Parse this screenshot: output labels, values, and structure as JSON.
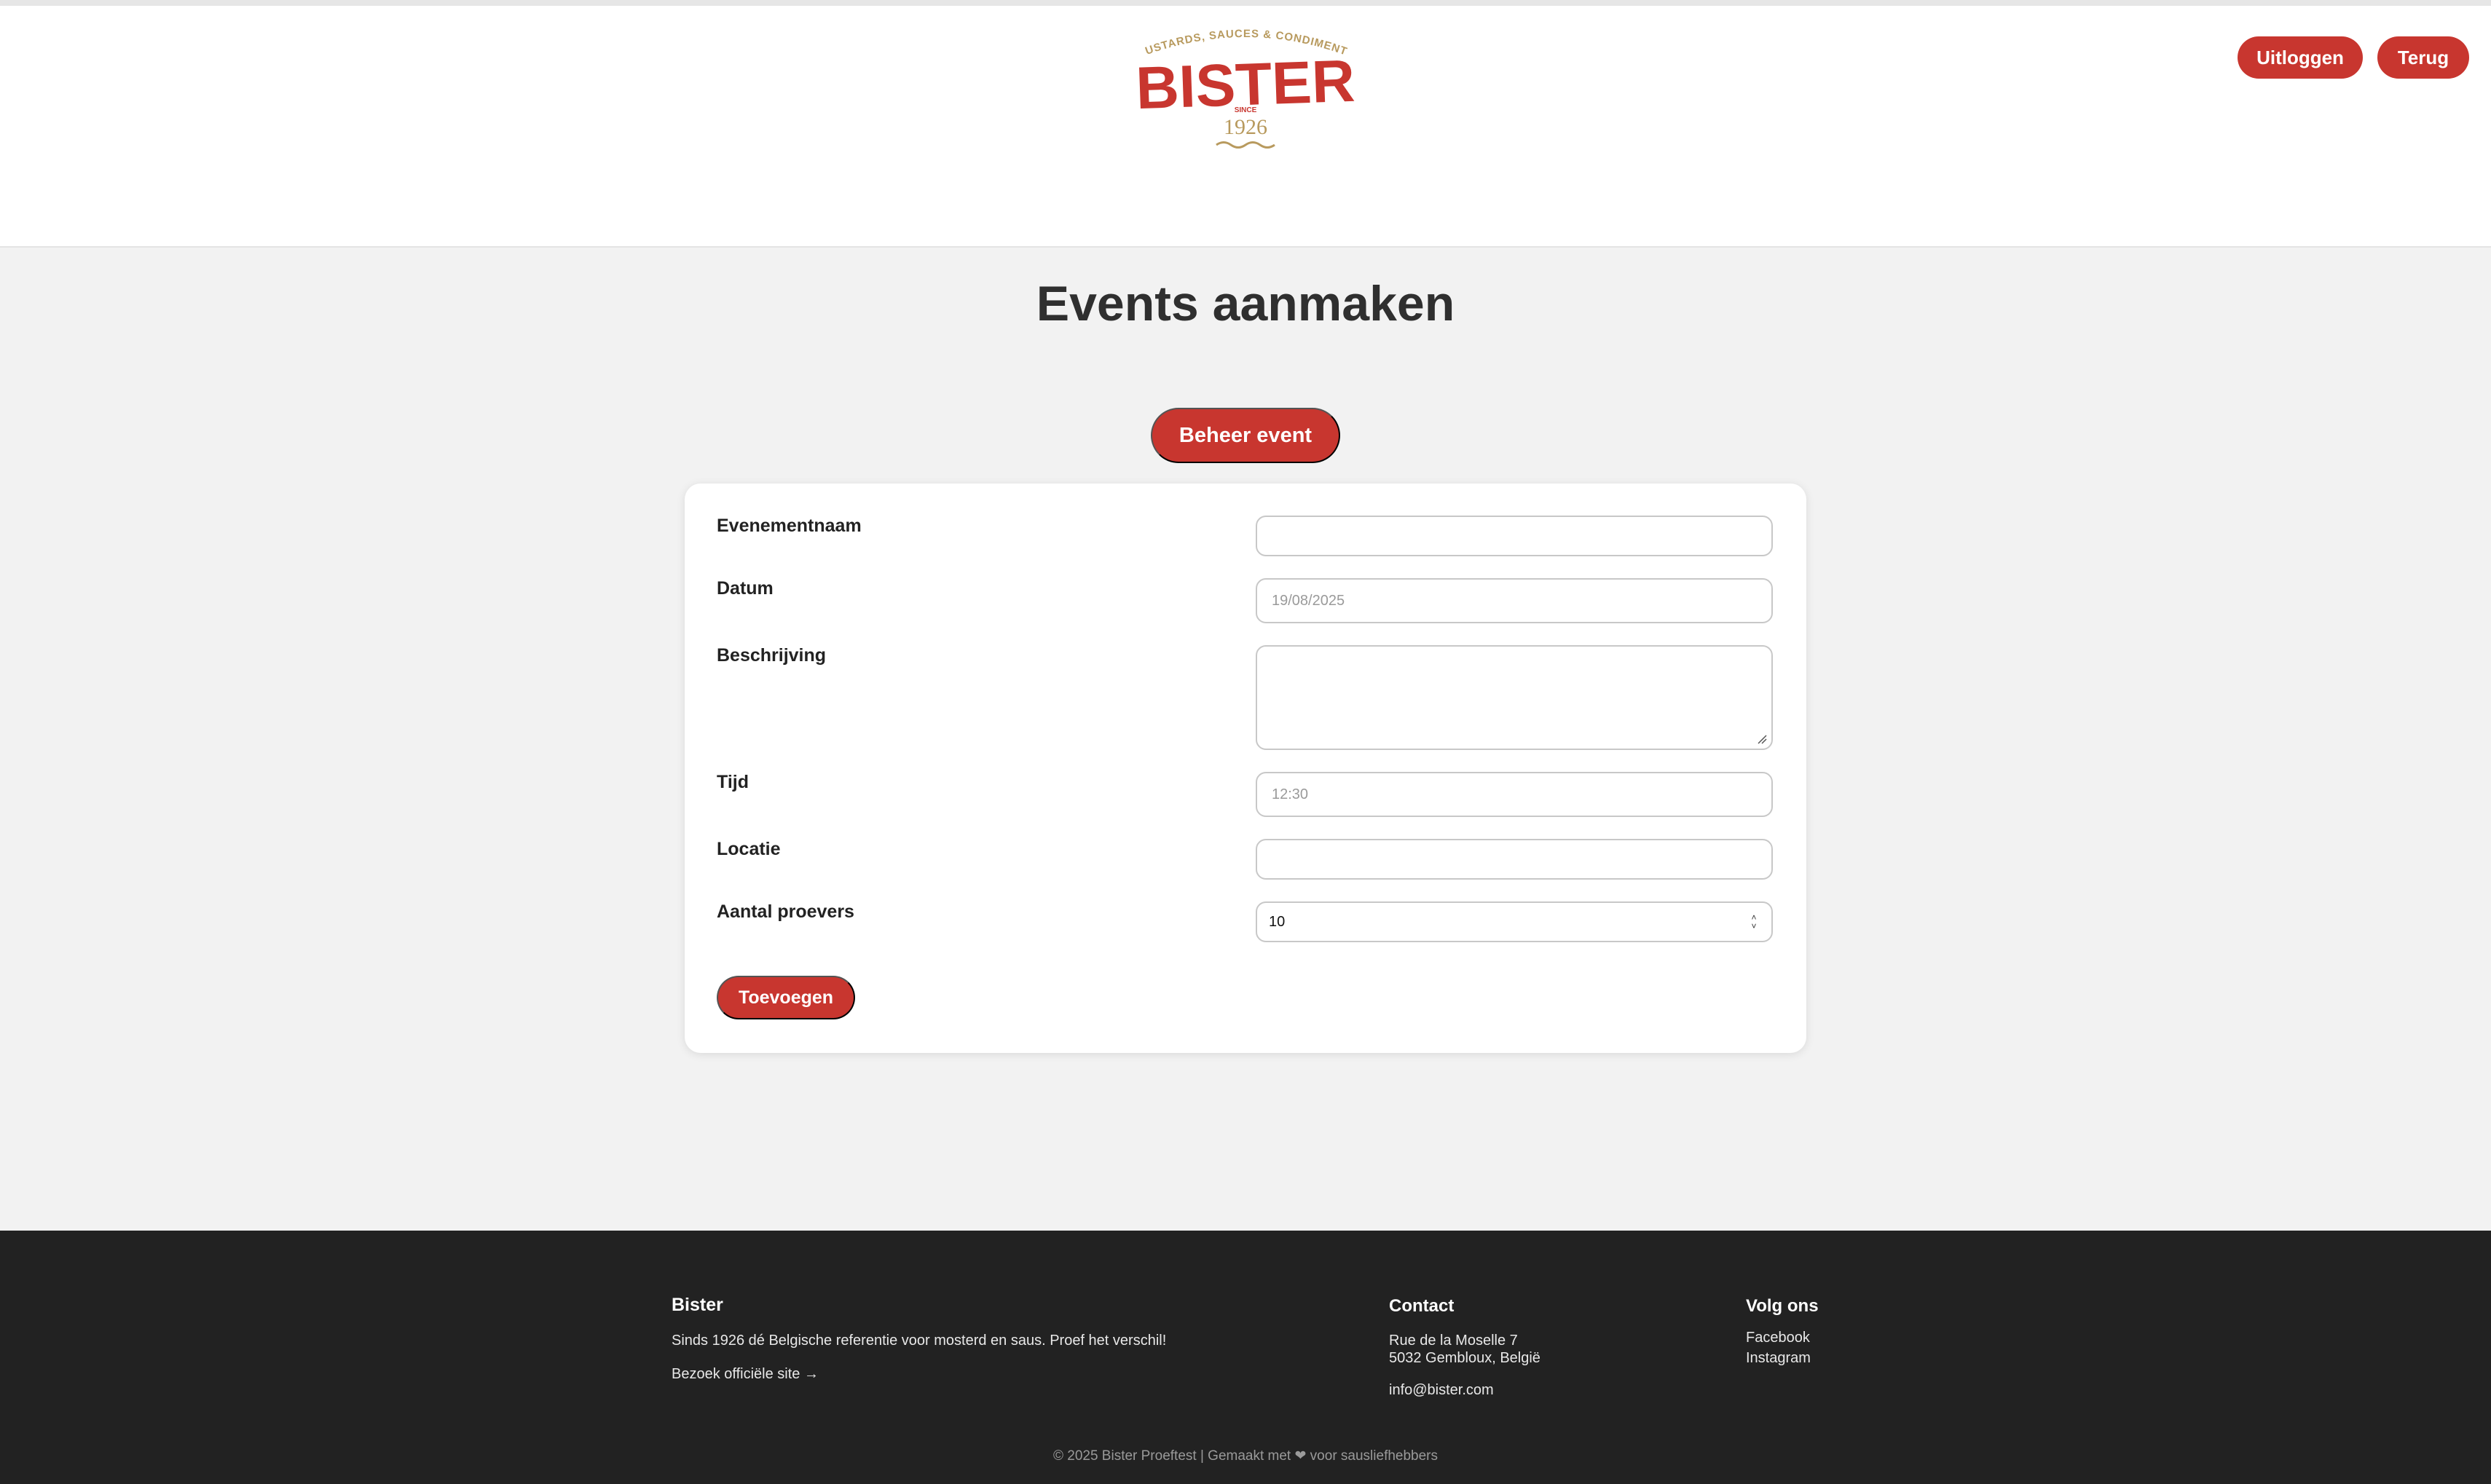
{
  "header": {
    "logo": {
      "tagline": "MUSTARDS, SAUCES & CONDIMENTS",
      "brand": "BISTER",
      "since": "SINCE",
      "year": "1926"
    },
    "logout_label": "Uitloggen",
    "back_label": "Terug"
  },
  "main": {
    "title": "Events aanmaken",
    "manage_label": "Beheer event"
  },
  "form": {
    "fields": [
      {
        "label": "Evenementnaam",
        "value": ""
      },
      {
        "label": "Datum",
        "value": "19/08/2025"
      },
      {
        "label": "Beschrijving",
        "value": ""
      },
      {
        "label": "Tijd",
        "value": "12:30"
      },
      {
        "label": "Locatie",
        "value": ""
      },
      {
        "label": "Aantal proevers",
        "value": "10"
      }
    ],
    "submit_label": "Toevoegen"
  },
  "footer": {
    "brand_title": "Bister",
    "brand_text": "Sinds 1926 dé Belgische referentie voor mosterd en saus. Proef het verschil!",
    "site_link": "Bezoek officiële site →",
    "contact_title": "Contact",
    "address_line1": "Rue de la Moselle 7",
    "address_line2": "5032 Gembloux, België",
    "email": "info@bister.com",
    "social_title": "Volg ons",
    "facebook": "Facebook",
    "instagram": "Instagram",
    "copyright": "© 2025 Bister Proeftest | Gemaakt met ❤ voor sausliefhebbers"
  },
  "colors": {
    "accent": "#c8362f",
    "logo_gold": "#b89a5e",
    "footer_bg": "#222222",
    "page_bg": "#f2f2f2"
  }
}
